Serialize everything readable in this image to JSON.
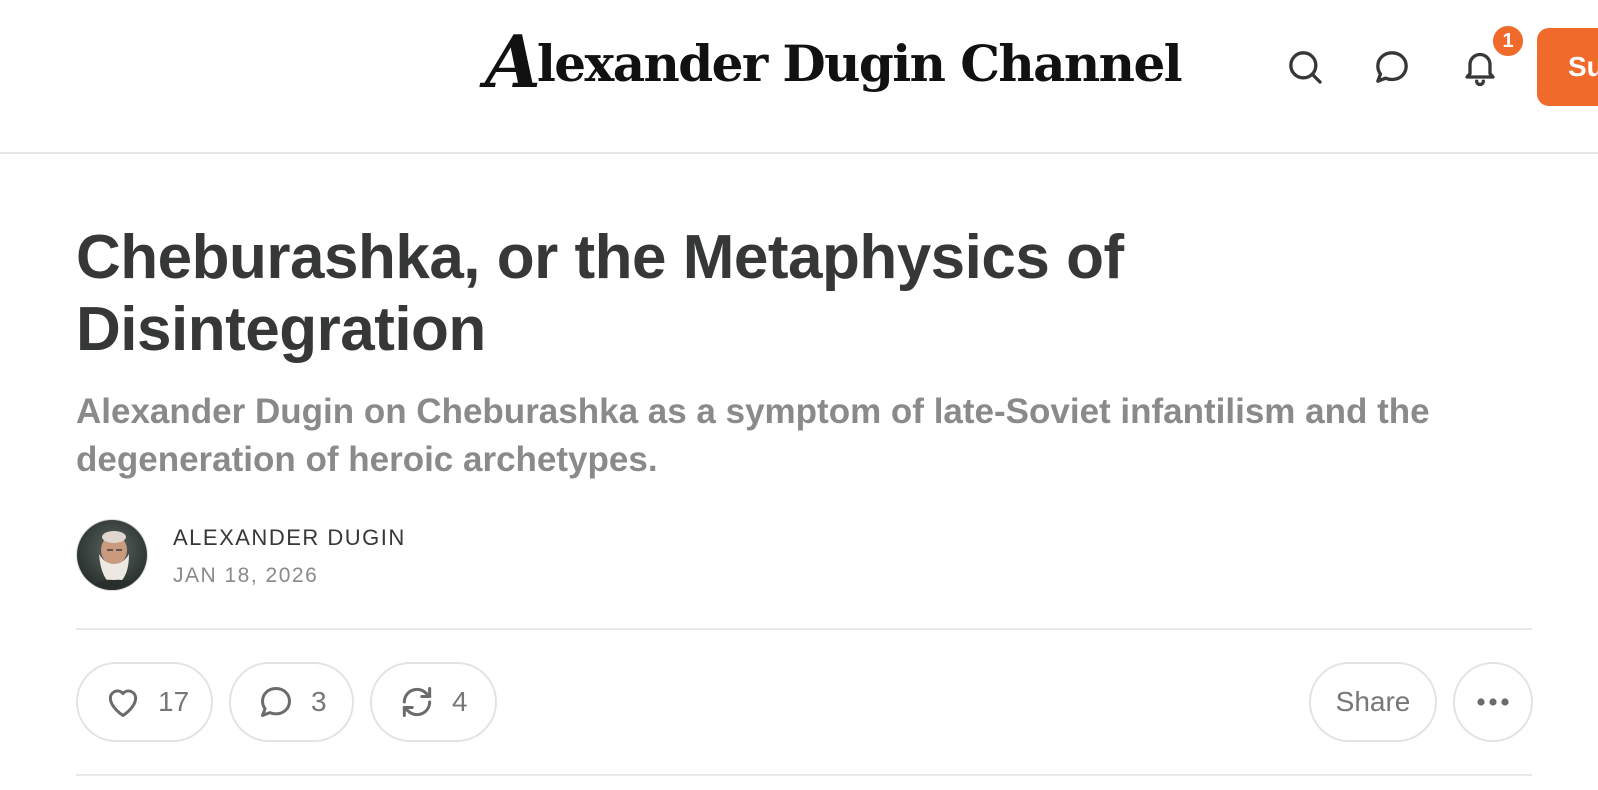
{
  "header": {
    "site_title_initial": "A",
    "site_title_rest": "lexander Dugin Channel",
    "notification_count": "1",
    "subscribe_label": "Subscribe",
    "icons": [
      "search-icon",
      "chat-bubble-icon",
      "bell-icon"
    ],
    "accent_color": "#ef6a2b"
  },
  "post": {
    "title": "Cheburashka, or the Metaphysics of Disintegration",
    "subtitle": "Alexander Dugin on Cheburashka as a symptom of late-Soviet infantilism and the degeneration of heroic archetypes.",
    "author": "ALEXANDER DUGIN",
    "date": "JAN 18, 2026"
  },
  "actions": {
    "likes": "17",
    "comments": "3",
    "restacks": "4",
    "share_label": "Share",
    "icons": [
      "heart-icon",
      "comment-icon",
      "restack-icon",
      "more-dots-icon"
    ]
  }
}
